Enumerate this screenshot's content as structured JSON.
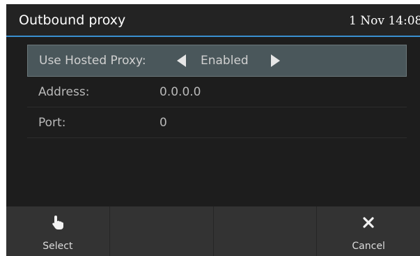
{
  "header": {
    "title": "Outbound proxy",
    "datetime": "1 Nov 14:08"
  },
  "settings": {
    "rows": [
      {
        "label": "Use Hosted Proxy:",
        "value": "Enabled"
      },
      {
        "label": "Address:",
        "value": "0.0.0.0"
      },
      {
        "label": "Port:",
        "value": "0"
      }
    ]
  },
  "softkeys": {
    "select_label": "Select",
    "select_icon": "hand-pointer-icon",
    "cancel_label": "Cancel",
    "cancel_icon": "close-icon"
  },
  "colors": {
    "accent": "#3a8fd0",
    "selected_row": "#4a575b",
    "softkey_bar": "#333333"
  }
}
